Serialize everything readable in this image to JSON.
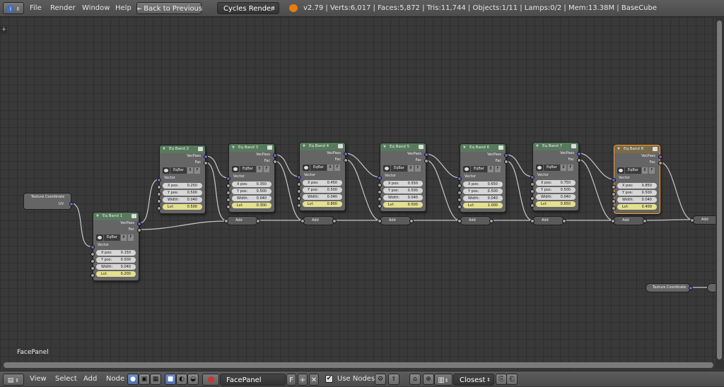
{
  "top_header": {
    "editor_icon": "info-icon",
    "menus": [
      "File",
      "Render",
      "Window",
      "Help"
    ],
    "back_button": "Back to Previous",
    "render_engine": "Cycles Render",
    "stats": "v2.79 | Verts:6,017 | Faces:5,872 | Tris:11,744 | Objects:1/11 | Lamps:0/2 | Mem:13.38M | BaseCube"
  },
  "canvas": {
    "frame_label": "FacePanel",
    "colors": {
      "grid_bg": "#393939",
      "node_header": "#577a5c",
      "selected_outline": "#ff9a2e",
      "level_field": "#e3e08f",
      "vector_socket": "#6464c8"
    }
  },
  "texture_coord_node": {
    "title": "Texture Coordinate",
    "output": "UV"
  },
  "texture_coord_node_2": {
    "title": "Texture Coordinate"
  },
  "eq_nodes": [
    {
      "title": "Eq Band 1",
      "outputs": [
        "VecPass",
        "Fac"
      ],
      "group": "EqBar",
      "group_users": "8",
      "fake_user": "F",
      "input_label": "Vector",
      "fields": [
        {
          "label": "X pos:",
          "value": "0.150"
        },
        {
          "label": "Y pos:",
          "value": "0.500"
        },
        {
          "label": "Width:",
          "value": "0.040"
        },
        {
          "label": "Lvl:",
          "value": "0.200"
        }
      ]
    },
    {
      "title": "Eq Band 2",
      "outputs": [
        "VecPass",
        "Fac"
      ],
      "group": "EqBar",
      "group_users": "8",
      "fake_user": "F",
      "input_label": "Vector",
      "fields": [
        {
          "label": "X pos:",
          "value": "0.250"
        },
        {
          "label": "Y pos:",
          "value": "0.500"
        },
        {
          "label": "Width:",
          "value": "0.040"
        },
        {
          "label": "Lvl:",
          "value": "0.500"
        }
      ]
    },
    {
      "title": "Eq Band 3",
      "outputs": [
        "VecPass",
        "Fac"
      ],
      "group": "EqBar",
      "group_users": "8",
      "fake_user": "F",
      "input_label": "Vector",
      "fields": [
        {
          "label": "X pos:",
          "value": "0.350"
        },
        {
          "label": "Y pos:",
          "value": "0.500"
        },
        {
          "label": "Width:",
          "value": "0.040"
        },
        {
          "label": "Lvl:",
          "value": "0.300"
        }
      ]
    },
    {
      "title": "Eq Band 4",
      "outputs": [
        "VecPass",
        "Fac"
      ],
      "group": "EqBar",
      "group_users": "8",
      "fake_user": "F",
      "input_label": "Vector",
      "fields": [
        {
          "label": "X pos:",
          "value": "0.450"
        },
        {
          "label": "Y pos:",
          "value": "0.500"
        },
        {
          "label": "Width:",
          "value": "0.040"
        },
        {
          "label": "Lvl:",
          "value": "0.800"
        }
      ]
    },
    {
      "title": "Eq Band 5",
      "outputs": [
        "VecPass",
        "Fac"
      ],
      "group": "EqBar",
      "group_users": "8",
      "fake_user": "F",
      "input_label": "Vector",
      "fields": [
        {
          "label": "X pos:",
          "value": "0.550"
        },
        {
          "label": "Y pos:",
          "value": "0.500"
        },
        {
          "label": "Width:",
          "value": "0.040"
        },
        {
          "label": "Lvl:",
          "value": "0.500"
        }
      ]
    },
    {
      "title": "Eq Band 6",
      "outputs": [
        "VecPass",
        "Fac"
      ],
      "group": "EqBar",
      "group_users": "8",
      "fake_user": "F",
      "input_label": "Vector",
      "fields": [
        {
          "label": "X pos:",
          "value": "0.650"
        },
        {
          "label": "Y pos:",
          "value": "0.500"
        },
        {
          "label": "Width:",
          "value": "0.040"
        },
        {
          "label": "Lvl:",
          "value": "1.000"
        }
      ]
    },
    {
      "title": "Eq Band 7",
      "outputs": [
        "VecPass",
        "Fac"
      ],
      "group": "EqBar",
      "group_users": "8",
      "fake_user": "F",
      "input_label": "Vector",
      "fields": [
        {
          "label": "X pos:",
          "value": "0.750"
        },
        {
          "label": "Y pos:",
          "value": "0.500"
        },
        {
          "label": "Width:",
          "value": "0.040"
        },
        {
          "label": "Lvl:",
          "value": "0.650"
        }
      ]
    },
    {
      "title": "Eq Band 8",
      "outputs": [
        "VecPass",
        "Fac"
      ],
      "group": "EqBar",
      "group_users": "8",
      "fake_user": "F",
      "input_label": "Vector",
      "fields": [
        {
          "label": "X pos:",
          "value": "0.850"
        },
        {
          "label": "Y pos:",
          "value": "0.500"
        },
        {
          "label": "Width:",
          "value": "0.040"
        },
        {
          "label": "Lvl:",
          "value": "0.400"
        }
      ]
    }
  ],
  "add_label": "Add",
  "bottom_header": {
    "menus": [
      "View",
      "Select",
      "Add",
      "Node"
    ],
    "node_tree_name": "FacePanel",
    "fake_user": "F",
    "use_nodes_label": "Use Nodes",
    "use_nodes_checked": true,
    "snap_mode": "Closest"
  }
}
